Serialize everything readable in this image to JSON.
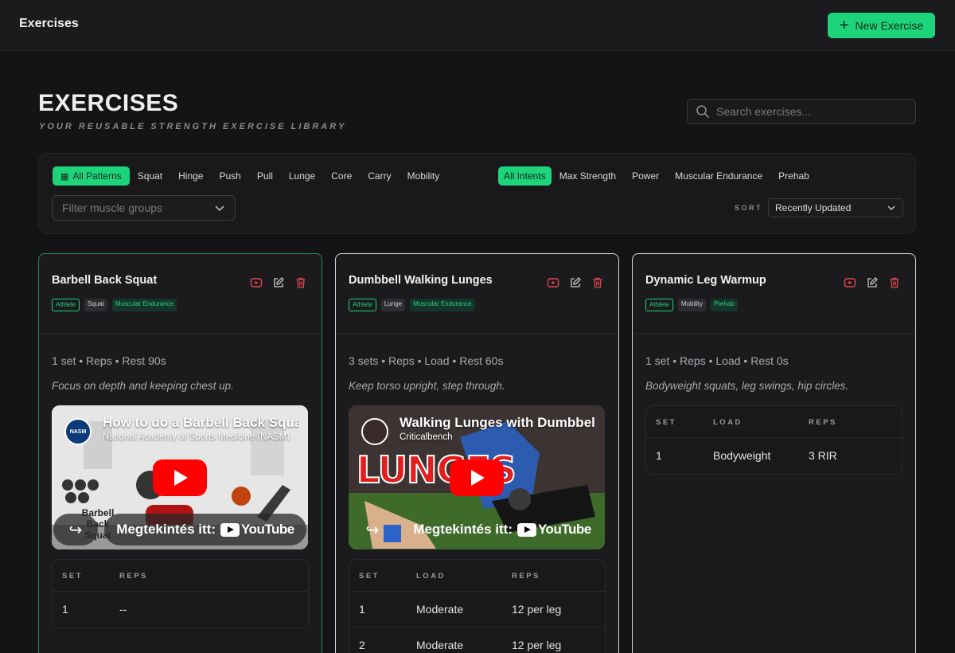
{
  "app": {
    "title": "Exercises",
    "new_button": "New Exercise"
  },
  "page": {
    "heading": "EXERCISES",
    "subtitle": "YOUR REUSABLE STRENGTH EXERCISE LIBRARY"
  },
  "search": {
    "placeholder": "Search exercises..."
  },
  "filters": {
    "patterns": [
      "All Patterns",
      "Squat",
      "Hinge",
      "Push",
      "Pull",
      "Lunge",
      "Core",
      "Carry",
      "Mobility"
    ],
    "active_pattern": "All Patterns",
    "intents": [
      "All Intents",
      "Max Strength",
      "Power",
      "Muscular Endurance",
      "Prehab"
    ],
    "active_intent": "All Intents",
    "muscle_placeholder": "Filter muscle groups",
    "sort_label": "SORT",
    "sort_value": "Recently Updated"
  },
  "colors": {
    "accent": "#1ed47a",
    "danger": "#e5484d",
    "background": "#141416"
  },
  "cards": [
    {
      "title": "Barbell Back Squat",
      "tags": [
        "Athlete",
        "Squat",
        "Muscular Endurance"
      ],
      "meta": "1 set  •  Reps  •  Rest 90s",
      "note": "Focus on depth and keeping chest up.",
      "video": {
        "title": "How to do a Barbell Back Squat",
        "channel": "National Academy of Sports Medicine (NASM)",
        "logo": "NASM",
        "watch": "Megtekintés itt:",
        "youtube": "YouTube",
        "caption": "Barbell Back Squat"
      },
      "columns": [
        "SET",
        "REPS"
      ],
      "rows": [
        [
          "1",
          "--"
        ]
      ]
    },
    {
      "title": "Dumbbell Walking Lunges",
      "tags": [
        "Athlete",
        "Lunge",
        "Muscular Endurance"
      ],
      "meta": "3 sets  •  Reps  •  Load  •  Rest 60s",
      "note": "Keep torso upright, step through.",
      "video": {
        "title": "Walking Lunges with Dumbbells",
        "channel": "Criticalbench",
        "watch": "Megtekintés itt:",
        "youtube": "YouTube",
        "caption": "LUNGES"
      },
      "columns": [
        "SET",
        "LOAD",
        "REPS"
      ],
      "rows": [
        [
          "1",
          "Moderate",
          "12 per leg"
        ],
        [
          "2",
          "Moderate",
          "12 per leg"
        ]
      ]
    },
    {
      "title": "Dynamic Leg Warmup",
      "tags": [
        "Athlete",
        "Mobility",
        "Prehab"
      ],
      "meta": "1 set  •  Reps  •  Load  •  Rest 0s",
      "note": "Bodyweight squats, leg swings, hip circles.",
      "columns": [
        "SET",
        "LOAD",
        "REPS"
      ],
      "rows": [
        [
          "1",
          "Bodyweight",
          "3 RIR"
        ]
      ]
    }
  ]
}
